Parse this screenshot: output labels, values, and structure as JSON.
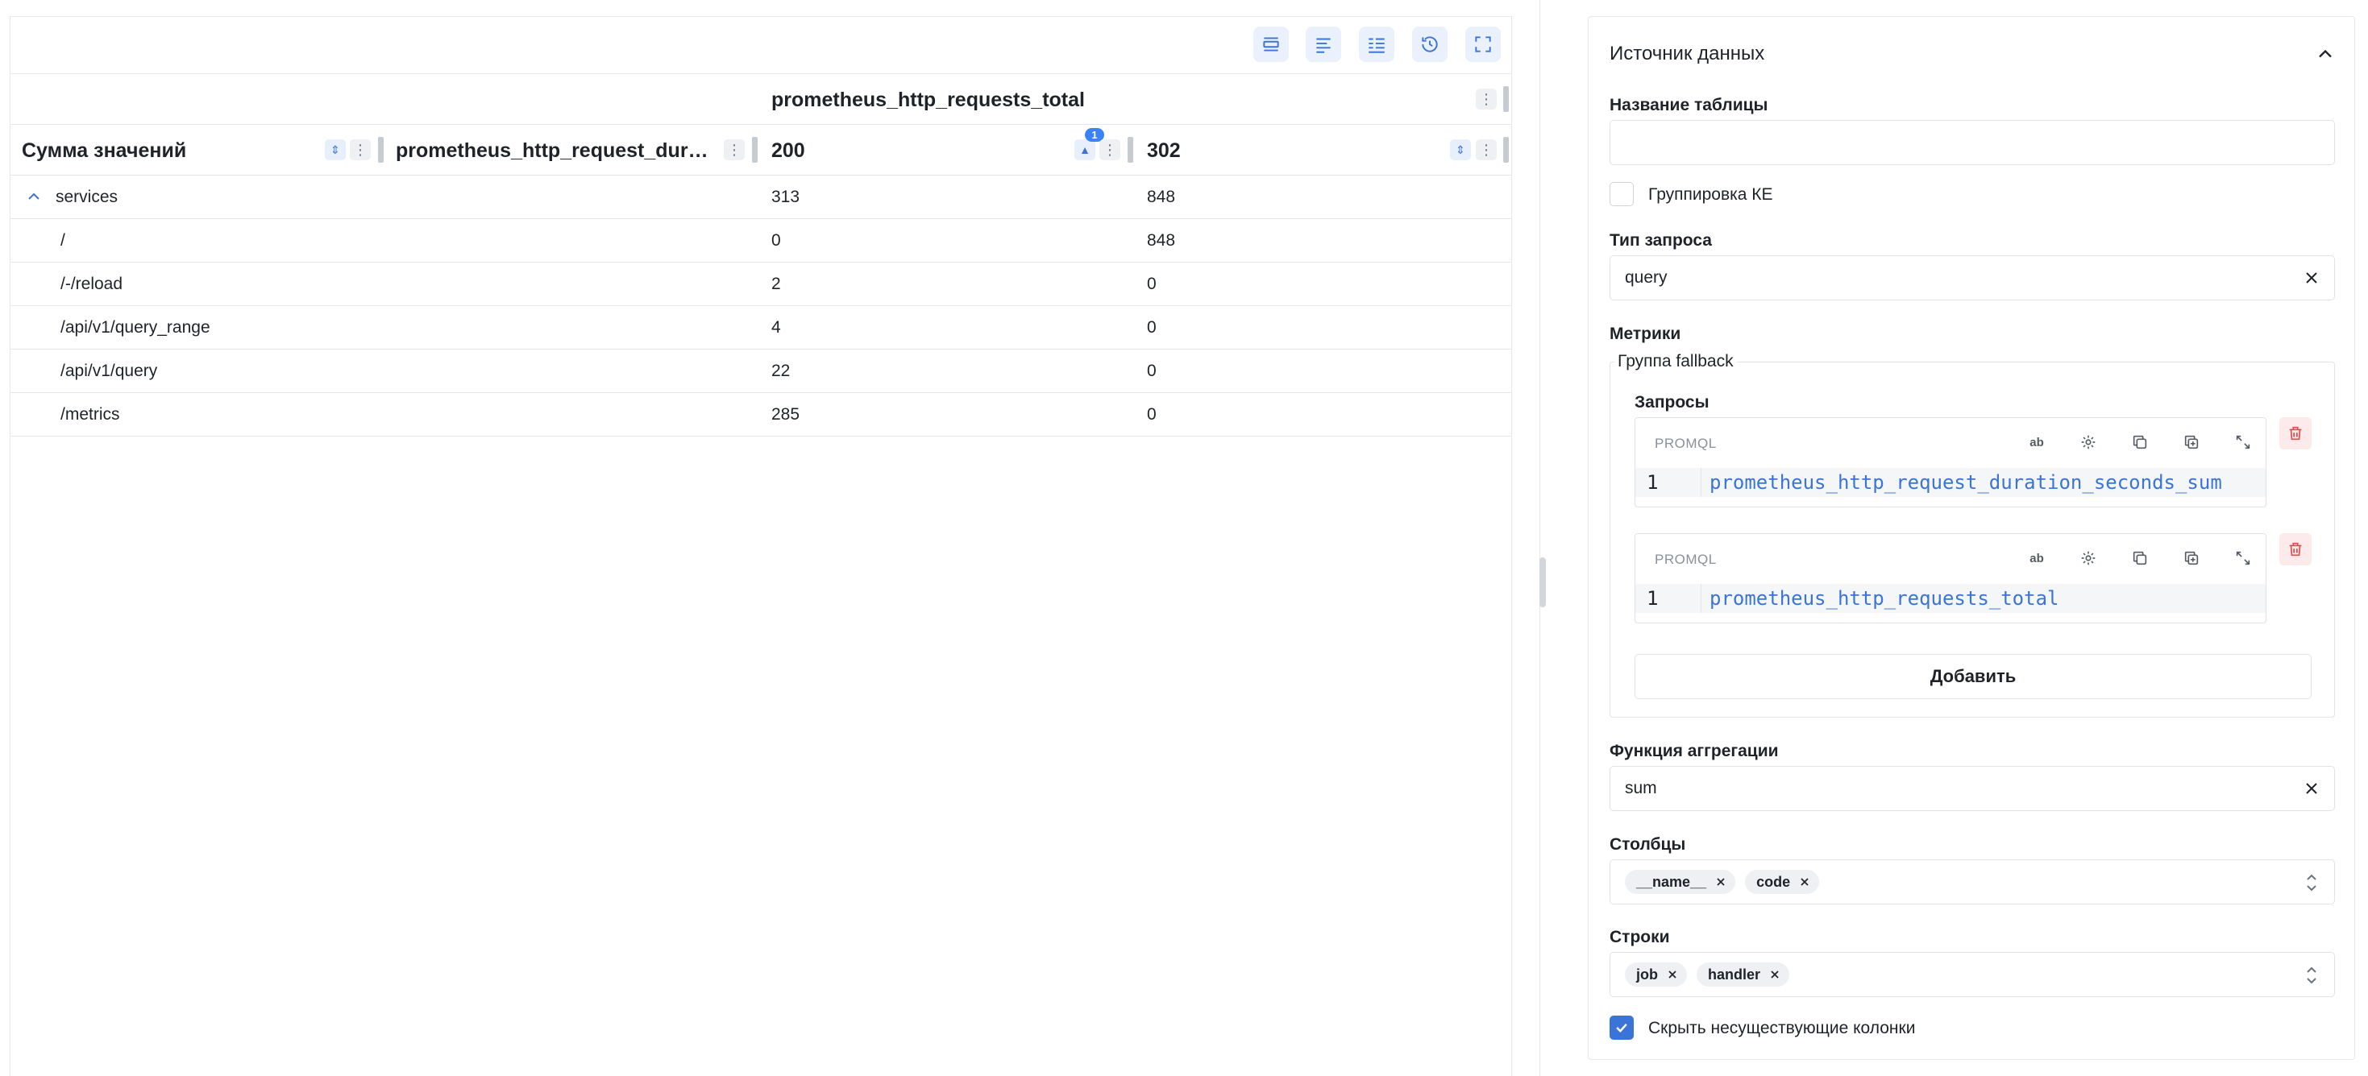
{
  "table": {
    "group_header": "prometheus_http_requests_total",
    "columns": {
      "sum": "Сумма значений",
      "duration": "prometheus_http_request_duration_seconds_sum",
      "c200": "200",
      "c302": "302"
    },
    "sort_badge": "1",
    "rows": [
      {
        "label": "services",
        "v200": "313",
        "v302": "848"
      },
      {
        "label": "/",
        "v200": "0",
        "v302": "848"
      },
      {
        "label": "/-/reload",
        "v200": "2",
        "v302": "0"
      },
      {
        "label": "/api/v1/query_range",
        "v200": "4",
        "v302": "0"
      },
      {
        "label": "/api/v1/query",
        "v200": "22",
        "v302": "0"
      },
      {
        "label": "/metrics",
        "v200": "285",
        "v302": "0"
      }
    ]
  },
  "settings": {
    "title": "Источник данных",
    "table_name_label": "Название таблицы",
    "table_name_value": "",
    "group_ke_label": "Группировка КЕ",
    "query_type_label": "Тип запроса",
    "query_type_value": "query",
    "metrics_label": "Метрики",
    "fallback_group_label": "Группа fallback",
    "queries_label": "Запросы",
    "queries": [
      {
        "lang": "PROMQL",
        "line": "1",
        "code": "prometheus_http_request_duration_seconds_sum",
        "ab": "ab"
      },
      {
        "lang": "PROMQL",
        "line": "1",
        "code": "prometheus_http_requests_total",
        "ab": "ab"
      }
    ],
    "add_label": "Добавить",
    "aggregation_label": "Функция аггрегации",
    "aggregation_value": "sum",
    "columns_label": "Столбцы",
    "columns_chips": [
      "__name__",
      "code"
    ],
    "rows_label": "Строки",
    "rows_chips": [
      "job",
      "handler"
    ],
    "hide_columns_label": "Скрыть несуществующие колонки",
    "hide_columns_checked": true
  },
  "colors": {
    "accent": "#3b74d9",
    "danger": "#e5484d",
    "border": "#e4e6ea"
  }
}
